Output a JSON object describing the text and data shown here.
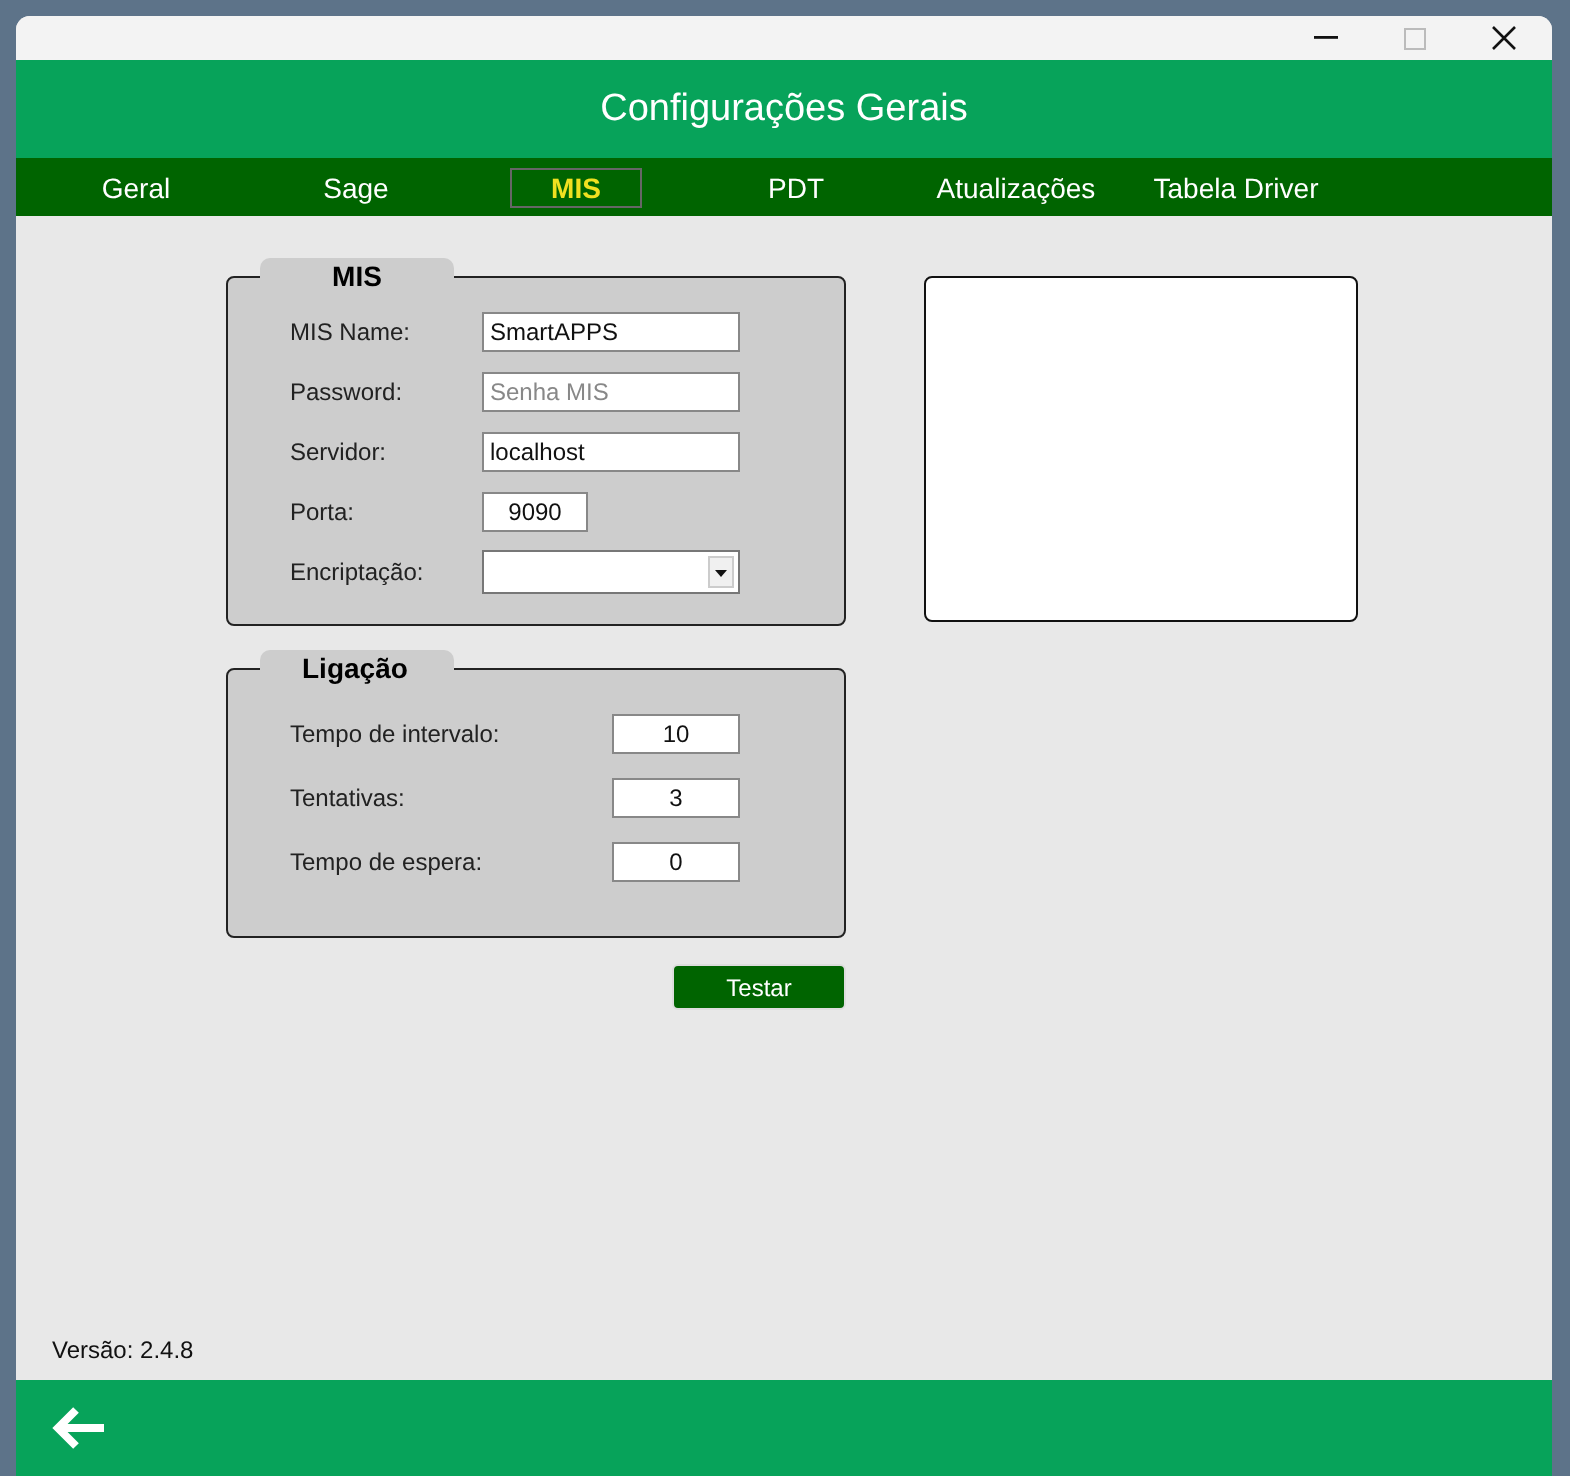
{
  "window": {
    "title": "Configurações Gerais"
  },
  "tabs": [
    {
      "label": "Geral",
      "selected": false
    },
    {
      "label": "Sage",
      "selected": false
    },
    {
      "label": "MIS",
      "selected": true
    },
    {
      "label": "PDT",
      "selected": false
    },
    {
      "label": "Atualizações",
      "selected": false
    },
    {
      "label": "Tabela Driver",
      "selected": false
    }
  ],
  "groups": [
    {
      "title": "MIS",
      "fields": [
        {
          "kind": "text",
          "label": "MIS Name:",
          "value": "SmartAPPS"
        },
        {
          "kind": "text",
          "label": "Password:",
          "placeholder": "Senha MIS"
        },
        {
          "kind": "text",
          "label": "Servidor:",
          "value": "localhost"
        },
        {
          "kind": "short",
          "label": "Porta:",
          "value": "9090"
        },
        {
          "kind": "select",
          "label": "Encriptação:"
        }
      ]
    },
    {
      "title": "Ligação",
      "fields": [
        {
          "kind": "number",
          "label": "Tempo de intervalo:",
          "value": "10"
        },
        {
          "kind": "number",
          "label": "Tentativas:",
          "value": "3"
        },
        {
          "kind": "number",
          "label": "Tempo de espera:",
          "value": "0"
        }
      ]
    }
  ],
  "test_button": "Testar",
  "version": "Versão: 2.4.8"
}
